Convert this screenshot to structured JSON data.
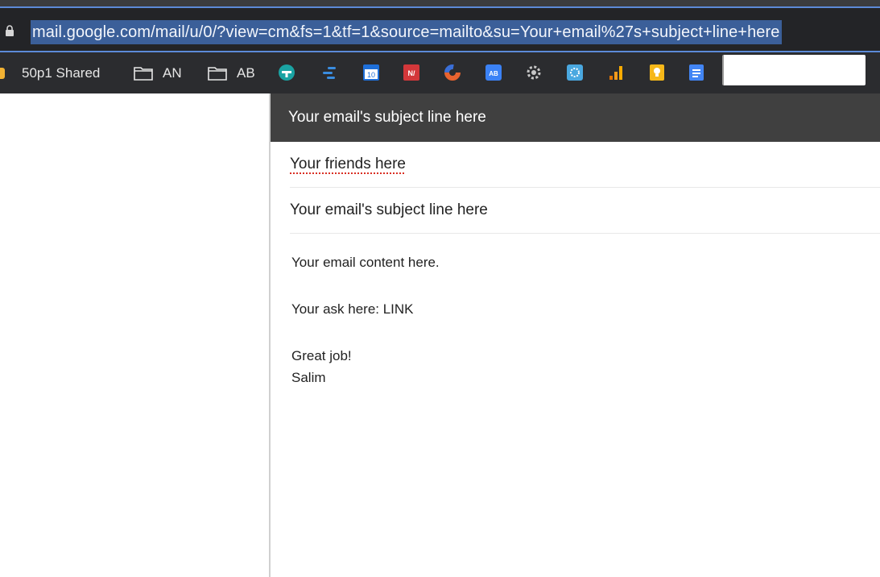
{
  "address_bar": {
    "url": "mail.google.com/mail/u/0/?view=cm&fs=1&tf=1&source=mailto&su=Your+email%27s+subject+line+here"
  },
  "bookmarks": {
    "items": [
      {
        "label": "50p1 Shared",
        "icon": "bookmark-icon"
      },
      {
        "label": "AN",
        "icon": "folder-icon"
      },
      {
        "label": "AB",
        "icon": "folder-icon"
      }
    ],
    "extensions": [
      {
        "icon": "teal-circle-extension-icon",
        "color": "#1aa3a3"
      },
      {
        "icon": "bars-extension-icon",
        "color": "#3a8de0"
      },
      {
        "icon": "calendar-extension-icon",
        "color": "#1e6fd9",
        "text": "10"
      },
      {
        "icon": "notion-extension-icon",
        "color": "#d3373a",
        "text": "N/"
      },
      {
        "icon": "donut-extension-icon",
        "color": "#e8632f"
      },
      {
        "icon": "ab-extension-icon",
        "color": "#3b82f6",
        "text": "AB"
      },
      {
        "icon": "gear-extension-icon",
        "color": "#c7c7c7"
      },
      {
        "icon": "snowflake-extension-icon",
        "color": "#4aa8e0"
      },
      {
        "icon": "analytics-extension-icon",
        "color": "#f29b1d"
      },
      {
        "icon": "keep-extension-icon",
        "color": "#f6b819"
      },
      {
        "icon": "docs-extension-icon",
        "color": "#4285f4"
      }
    ]
  },
  "compose": {
    "header_title": "Your email's subject line here",
    "to_value": "Your friends here",
    "subject_value": "Your email's subject line here",
    "body": {
      "line1": "Your email content here.",
      "line2": "Your ask here: LINK",
      "closing": "Great job!",
      "signature": "Salim"
    }
  }
}
